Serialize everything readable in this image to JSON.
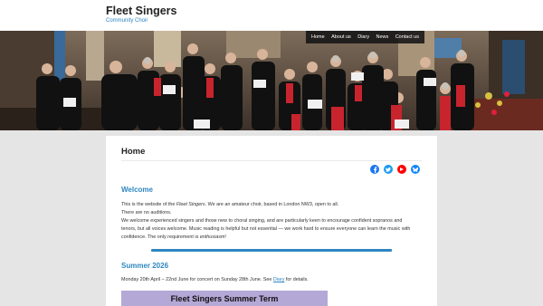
{
  "site": {
    "title": "Fleet Singers",
    "tagline": "Community Choir"
  },
  "nav": {
    "items": [
      "Home",
      "About us",
      "Diary",
      "News",
      "Contact us"
    ]
  },
  "hero": {
    "alt": "Choir performing in a church"
  },
  "page": {
    "title": "Home"
  },
  "social": {
    "items": [
      {
        "name": "facebook",
        "color": "#1877f2"
      },
      {
        "name": "twitter",
        "color": "#1d9bf0"
      },
      {
        "name": "youtube",
        "color": "#ff0000"
      },
      {
        "name": "bluesky",
        "color": "#1185fe"
      }
    ]
  },
  "welcome": {
    "heading": "Welcome",
    "line1_prefix": "This is the website of the ",
    "line1_em": "Fleet Singers",
    "line1_suffix": ". We are an amateur choir, based in London NW3, open to all.",
    "line2": "There are no auditions.",
    "line3": "We welcome experienced singers and those new to choral singing, and are particularly keen to encourage confident sopranos and",
    "line4": "tenors, but all voices welcome. Music reading is helpful but not essential — we work hard to ensure everyone can learn the music with",
    "line5_prefix": "confidence. The only requirement is ",
    "line5_em": "enthusiasm",
    "line5_suffix": "!"
  },
  "summer": {
    "heading": "Summer 2026",
    "text_prefix": "Monday 20th April – 22nd June for concert on Sunday 28th June. See ",
    "link": "Diary",
    "text_suffix": " for details.",
    "banner": "Fleet Singers Summer Term"
  },
  "colors": {
    "accent": "#2e86c1",
    "banner_bg": "#b3a8d6"
  }
}
